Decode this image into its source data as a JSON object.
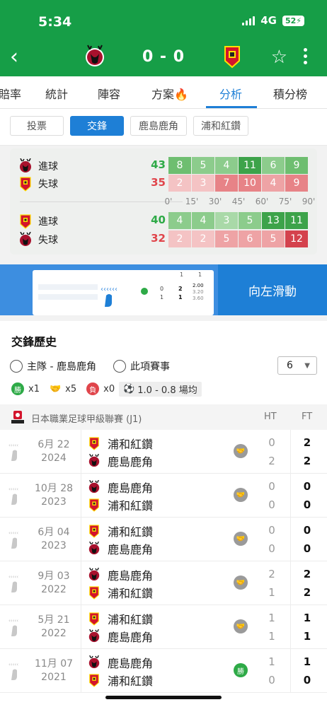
{
  "status": {
    "time": "5:34",
    "network": "4G",
    "battery": "52"
  },
  "header": {
    "score": "0 - 0",
    "back_icon": "chevron-left-icon",
    "star_icon": "star-icon",
    "more_icon": "more-vertical-icon"
  },
  "tabs": [
    {
      "label": "賠率",
      "active": false
    },
    {
      "label": "統計",
      "active": false
    },
    {
      "label": "陣容",
      "active": false
    },
    {
      "label": "方案",
      "active": false,
      "icon": "fire-icon"
    },
    {
      "label": "分析",
      "active": true
    },
    {
      "label": "積分榜",
      "active": false
    }
  ],
  "subtabs": [
    {
      "label": "投票",
      "active": false
    },
    {
      "label": "交鋒",
      "active": true
    },
    {
      "label": "鹿島鹿角",
      "active": false
    },
    {
      "label": "浦和紅鑽",
      "active": false
    }
  ],
  "goal_stats": {
    "ticks": [
      "0'",
      "15'",
      "30'",
      "45'",
      "60'",
      "75'",
      "90'"
    ],
    "rows": [
      {
        "team": "kashima",
        "label": "進球",
        "total": "43",
        "kind": "scored",
        "values": [
          8,
          5,
          4,
          11,
          6,
          9
        ]
      },
      {
        "team": "urawa",
        "label": "失球",
        "total": "35",
        "kind": "conceded",
        "values": [
          2,
          3,
          7,
          10,
          4,
          9
        ]
      },
      {
        "team": "urawa",
        "label": "進球",
        "total": "40",
        "kind": "scored",
        "values": [
          4,
          4,
          3,
          5,
          13,
          11
        ]
      },
      {
        "team": "kashima",
        "label": "失球",
        "total": "32",
        "kind": "conceded",
        "values": [
          2,
          2,
          5,
          6,
          5,
          12
        ]
      }
    ]
  },
  "banner": {
    "cta": "向左滑動",
    "preview": {
      "left_top": "0",
      "left_bottom": "1",
      "mid_top": "2",
      "mid_bottom": "1",
      "odds": [
        "2.00",
        "3.20",
        "3.60"
      ],
      "col_a": "1",
      "col_b": "1"
    }
  },
  "h2h": {
    "title": "交鋒歷史",
    "filter_home": "主隊 - 鹿島鹿角",
    "filter_comp": "此項賽事",
    "count": "6",
    "summary": {
      "win_label": "勝",
      "win": "x1",
      "draw": "x5",
      "loss_label": "負",
      "loss": "x0",
      "avg": "1.0 - 0.8 場均"
    },
    "league": "日本職業足球甲級聯賽 (J1)",
    "col_ht": "HT",
    "col_ft": "FT",
    "matches": [
      {
        "date": "6月 22",
        "year": "2024",
        "home": "浦和紅鑽",
        "home_team": "urawa",
        "away": "鹿島鹿角",
        "away_team": "kashima",
        "result": "draw",
        "ht_home": "0",
        "ht_away": "2",
        "ft_home": "2",
        "ft_away": "2"
      },
      {
        "date": "10月 28",
        "year": "2023",
        "home": "鹿島鹿角",
        "home_team": "kashima",
        "away": "浦和紅鑽",
        "away_team": "urawa",
        "result": "draw",
        "ht_home": "0",
        "ht_away": "0",
        "ft_home": "0",
        "ft_away": "0"
      },
      {
        "date": "6月 04",
        "year": "2023",
        "home": "浦和紅鑽",
        "home_team": "urawa",
        "away": "鹿島鹿角",
        "away_team": "kashima",
        "result": "draw",
        "ht_home": "0",
        "ht_away": "0",
        "ft_home": "0",
        "ft_away": "0"
      },
      {
        "date": "9月 03",
        "year": "2022",
        "home": "鹿島鹿角",
        "home_team": "kashima",
        "away": "浦和紅鑽",
        "away_team": "urawa",
        "result": "draw",
        "ht_home": "2",
        "ht_away": "1",
        "ft_home": "2",
        "ft_away": "2"
      },
      {
        "date": "5月 21",
        "year": "2022",
        "home": "浦和紅鑽",
        "home_team": "urawa",
        "away": "鹿島鹿角",
        "away_team": "kashima",
        "result": "draw",
        "ht_home": "1",
        "ht_away": "1",
        "ft_home": "1",
        "ft_away": "1"
      },
      {
        "date": "11月 07",
        "year": "2021",
        "home": "鹿島鹿角",
        "home_team": "kashima",
        "away": "浦和紅鑽",
        "away_team": "urawa",
        "result": "win",
        "result_label": "勝",
        "ht_home": "1",
        "ht_away": "0",
        "ft_home": "1",
        "ft_away": "0"
      }
    ]
  },
  "colors": {
    "brand_green": "#169e47",
    "accent_blue": "#1e7fd6",
    "win_green": "#2eaa47",
    "loss_red": "#e0454b",
    "draw_gray": "#9a9a9a",
    "kashima_red": "#a8112d",
    "urawa_red": "#d3142c"
  }
}
